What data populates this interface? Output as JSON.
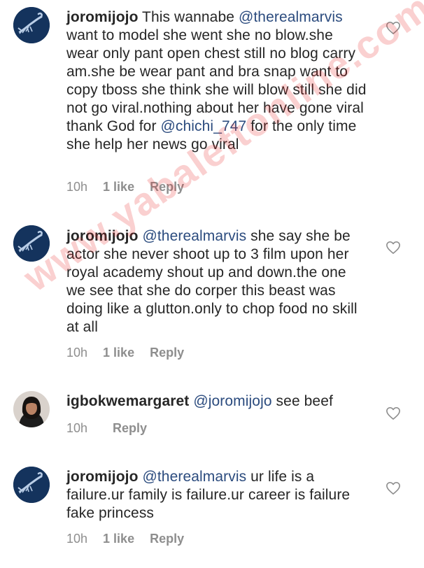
{
  "comments": [
    {
      "username": "joromijojo",
      "segments": [
        {
          "text": " This wannabe ",
          "mention": false
        },
        {
          "text": "@therealmarvis",
          "mention": true
        },
        {
          "text": " want to model she went she no blow.she wear only pant open chest still no blog carry am.she be wear pant and bra snap want to copy tboss she think she will blow still she did not go viral.nothing about her have gone viral thank God for ",
          "mention": false
        },
        {
          "text": "@chichi_747",
          "mention": true
        },
        {
          "text": " for the only time she help her news go viral",
          "mention": false
        }
      ],
      "time": "10h",
      "likes": "1 like",
      "reply": "Reply",
      "avatar": "scorpion-avatar"
    },
    {
      "username": "joromijojo",
      "segments": [
        {
          "text": " ",
          "mention": false
        },
        {
          "text": "@therealmarvis",
          "mention": true
        },
        {
          "text": " she say she be actor she never shoot up to 3 film upon her royal academy shout up and down.the one we see that she do corper this beast was doing like a glutton.only to chop food no skill at all",
          "mention": false
        }
      ],
      "time": "10h",
      "likes": "1 like",
      "reply": "Reply",
      "avatar": "scorpion-avatar"
    },
    {
      "username": "igbokwemargaret",
      "segments": [
        {
          "text": " ",
          "mention": false
        },
        {
          "text": "@joromijojo",
          "mention": true
        },
        {
          "text": " see beef",
          "mention": false
        }
      ],
      "time": "10h",
      "likes": "",
      "reply": "Reply",
      "avatar": "woman-avatar"
    },
    {
      "username": "joromijojo",
      "segments": [
        {
          "text": " ",
          "mention": false
        },
        {
          "text": "@therealmarvis",
          "mention": true
        },
        {
          "text": " ur life is a failure.ur family is failure.ur career is failure fake princess",
          "mention": false
        }
      ],
      "time": "10h",
      "likes": "1 like",
      "reply": "Reply",
      "avatar": "scorpion-avatar"
    }
  ],
  "watermark": "www.yabaleftonline.com",
  "colors": {
    "text": "#262626",
    "mention": "#2b4b7e",
    "meta": "#8e8e8e",
    "watermark": "rgba(230,40,40,0.22)"
  },
  "icons": {
    "like": "heart-outline-icon"
  }
}
